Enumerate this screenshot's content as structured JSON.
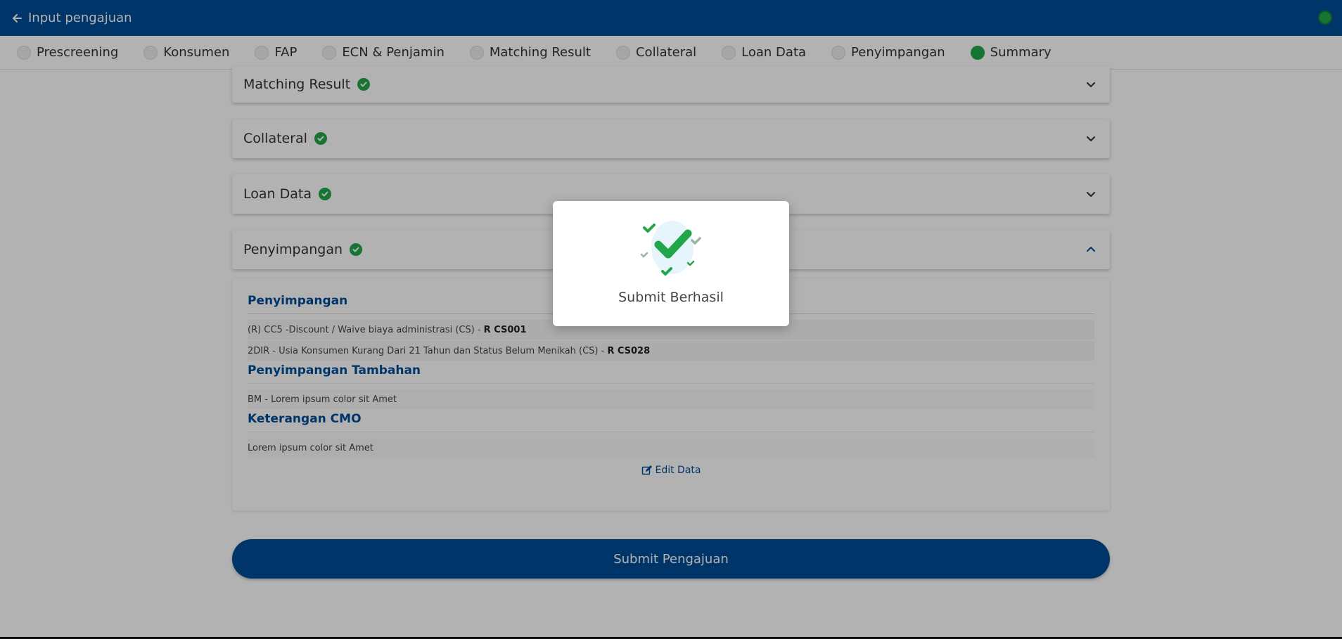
{
  "header": {
    "title": "Input pengajuan",
    "back_icon": "arrow-left-icon",
    "status_color": "#22a64a"
  },
  "stepper": {
    "steps": [
      {
        "label": "Prescreening",
        "active": false
      },
      {
        "label": "Konsumen",
        "active": false
      },
      {
        "label": "FAP",
        "active": false
      },
      {
        "label": "ECN & Penjamin",
        "active": false
      },
      {
        "label": "Matching Result",
        "active": false
      },
      {
        "label": "Collateral",
        "active": false
      },
      {
        "label": "Loan Data",
        "active": false
      },
      {
        "label": "Penyimpangan",
        "active": false
      },
      {
        "label": "Summary",
        "active": true
      }
    ]
  },
  "sections": {
    "matching_result": "Matching Result",
    "collateral": "Collateral",
    "loan_data": "Loan Data",
    "penyimpangan": "Penyimpangan"
  },
  "panel": {
    "penyimpangan_title": "Penyimpangan",
    "penyimpangan_rows": [
      {
        "text": "(R) CC5 -Discount / Waive biaya administrasi (CS) -",
        "code": "R CS001"
      },
      {
        "text": "2DIR - Usia Konsumen Kurang Dari 21 Tahun dan Status Belum Menikah (CS) -",
        "code": "R CS028"
      }
    ],
    "tambahan_title": "Penyimpangan Tambahan",
    "tambahan_row": "BM - Lorem ipsum color sit Amet",
    "cmo_title": "Keterangan CMO",
    "cmo_row": "Lorem ipsum color sit Amet",
    "edit_label": "Edit Data"
  },
  "submit_label": "Submit Pengajuan",
  "modal": {
    "message": "Submit Berhasil",
    "icon": "success-checkmarks-icon"
  },
  "colors": {
    "primary": "#004c97",
    "success": "#22a64a"
  }
}
